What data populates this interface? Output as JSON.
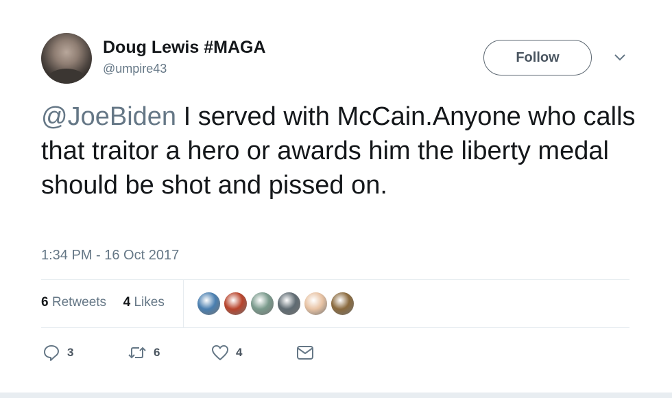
{
  "tweet": {
    "author": {
      "display_name": "Doug Lewis #MAGA",
      "handle": "@umpire43",
      "avatar_icon": "user-avatar-photo"
    },
    "follow_label": "Follow",
    "caret_icon": "chevron-down-icon",
    "mention": "@JoeBiden",
    "body": " I served with McCain.Anyone who calls that traitor a hero or awards him the liberty medal should be shot and pissed on.",
    "timestamp": "1:34 PM - 16 Oct 2017"
  },
  "stats": {
    "retweets_count": "6",
    "retweets_label": " Retweets",
    "likes_count": "4",
    "likes_label": " Likes"
  },
  "likers": [
    {
      "name": "liker-avatar-1",
      "color": "#4a7fb0"
    },
    {
      "name": "liker-avatar-2",
      "color": "#b8442c"
    },
    {
      "name": "liker-avatar-3",
      "color": "#7a9a8c"
    },
    {
      "name": "liker-avatar-4",
      "color": "#5f6b72"
    },
    {
      "name": "liker-avatar-5",
      "color": "#e8c3a4"
    },
    {
      "name": "liker-avatar-6",
      "color": "#8a6a3e"
    }
  ],
  "actions": {
    "reply": {
      "icon": "reply-icon",
      "count": "3"
    },
    "retweet": {
      "icon": "retweet-icon",
      "count": "6"
    },
    "like": {
      "icon": "heart-icon",
      "count": "4"
    },
    "message": {
      "icon": "envelope-icon"
    }
  },
  "colors": {
    "text": "#14171a",
    "secondary": "#657786",
    "border": "#e6ecf0"
  }
}
